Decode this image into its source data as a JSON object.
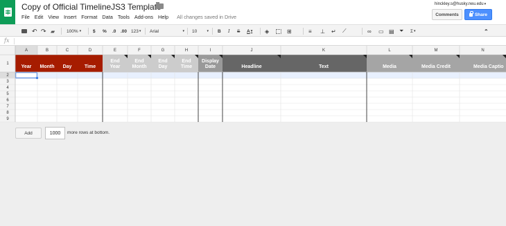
{
  "header": {
    "title": "Copy of Official TimelineJS3 Template",
    "user_email": "hinckley.s@husky.neu.edu",
    "comments_label": "Comments",
    "share_label": "Share",
    "menu": [
      "File",
      "Edit",
      "View",
      "Insert",
      "Format",
      "Data",
      "Tools",
      "Add-ons",
      "Help"
    ],
    "save_status": "All changes saved in Drive"
  },
  "toolbar": {
    "zoom": "100%",
    "currency": "$",
    "percent": "%",
    "decrease_decimal": ".0",
    "increase_decimal": ".00",
    "more_formats": "123",
    "font": "Arial",
    "font_size": "10",
    "bold": "B",
    "italic": "I",
    "strike": "S",
    "text_color": "A",
    "functions": "Σ"
  },
  "formula_bar": {
    "fx": "fx",
    "value": ""
  },
  "sheet": {
    "column_letters": [
      "A",
      "B",
      "C",
      "D",
      "E",
      "F",
      "G",
      "H",
      "I",
      "J",
      "K",
      "L",
      "M",
      "N"
    ],
    "row_numbers": [
      "1",
      "2",
      "3",
      "4",
      "5",
      "6",
      "7",
      "8",
      "9"
    ],
    "headers": [
      "Year",
      "Month",
      "Day",
      "Time",
      "End\nYear",
      "End\nMonth",
      "End\nDay",
      "End\nTime",
      "Display\nDate",
      "Headline",
      "Text",
      "Media",
      "Media Credit",
      "Media Captio"
    ],
    "colors": {
      "date_group": "#a61c00",
      "end_group": "#cccccc",
      "display_group": "#999999",
      "text_group": "#666666",
      "media_group": "#a5a5a5",
      "selection": "#4a86e8"
    },
    "selected_cell": "A2"
  },
  "footer": {
    "add_label": "Add",
    "rows_value": "1000",
    "rows_suffix": "more rows at bottom."
  }
}
